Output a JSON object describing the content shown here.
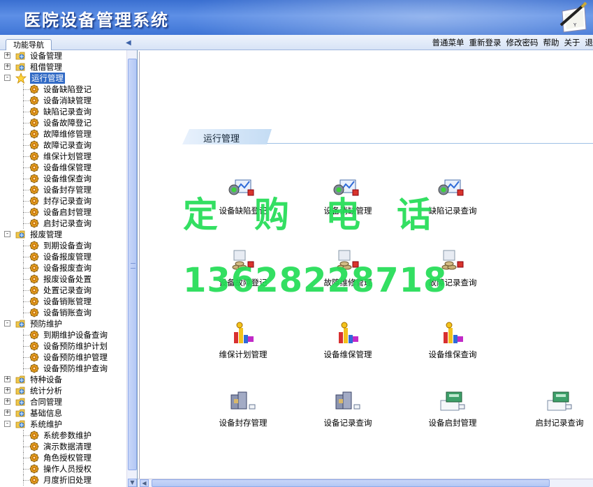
{
  "app": {
    "title": "医院设备管理系统"
  },
  "nav": {
    "tab_label": "功能导航"
  },
  "top_menu": [
    "普通菜单",
    "重新登录",
    "修改密码",
    "帮助",
    "关于",
    "退"
  ],
  "tree": [
    {
      "label": "设备管理",
      "level": 0,
      "expander": "+",
      "icon": "folder-icon"
    },
    {
      "label": "租借管理",
      "level": 0,
      "expander": "+",
      "icon": "folder-icon"
    },
    {
      "label": "运行管理",
      "level": 0,
      "expander": "-",
      "icon": "star-icon",
      "selected": true
    },
    {
      "label": "设备缺陷登记",
      "level": 1,
      "icon": "gear-icon"
    },
    {
      "label": "设备消缺管理",
      "level": 1,
      "icon": "gear-icon"
    },
    {
      "label": "缺陷记录查询",
      "level": 1,
      "icon": "gear-icon"
    },
    {
      "label": "设备故障登记",
      "level": 1,
      "icon": "gear-icon"
    },
    {
      "label": "故障维修管理",
      "level": 1,
      "icon": "gear-icon"
    },
    {
      "label": "故障记录查询",
      "level": 1,
      "icon": "gear-icon"
    },
    {
      "label": "维保计划管理",
      "level": 1,
      "icon": "gear-icon"
    },
    {
      "label": "设备维保管理",
      "level": 1,
      "icon": "gear-icon"
    },
    {
      "label": "设备维保查询",
      "level": 1,
      "icon": "gear-icon"
    },
    {
      "label": "设备封存管理",
      "level": 1,
      "icon": "gear-icon"
    },
    {
      "label": "封存记录查询",
      "level": 1,
      "icon": "gear-icon"
    },
    {
      "label": "设备启封管理",
      "level": 1,
      "icon": "gear-icon"
    },
    {
      "label": "启封记录查询",
      "level": 1,
      "icon": "gear-icon"
    },
    {
      "label": "报废管理",
      "level": 0,
      "expander": "-",
      "icon": "folder-icon"
    },
    {
      "label": "到期设备查询",
      "level": 1,
      "icon": "gear-icon"
    },
    {
      "label": "设备报废管理",
      "level": 1,
      "icon": "gear-icon"
    },
    {
      "label": "设备报废查询",
      "level": 1,
      "icon": "gear-icon"
    },
    {
      "label": "报废设备处置",
      "level": 1,
      "icon": "gear-icon"
    },
    {
      "label": "处置记录查询",
      "level": 1,
      "icon": "gear-icon"
    },
    {
      "label": "设备销账管理",
      "level": 1,
      "icon": "gear-icon"
    },
    {
      "label": "设备销账查询",
      "level": 1,
      "icon": "gear-icon"
    },
    {
      "label": "预防维护",
      "level": 0,
      "expander": "-",
      "icon": "folder-icon"
    },
    {
      "label": "到期维护设备查询",
      "level": 1,
      "icon": "gear-icon"
    },
    {
      "label": "设备预防维护计划",
      "level": 1,
      "icon": "gear-icon"
    },
    {
      "label": "设备预防维护管理",
      "level": 1,
      "icon": "gear-icon"
    },
    {
      "label": "设备预防维护查询",
      "level": 1,
      "icon": "gear-icon"
    },
    {
      "label": "特种设备",
      "level": 0,
      "expander": "+",
      "icon": "folder-icon"
    },
    {
      "label": "统计分析",
      "level": 0,
      "expander": "+",
      "icon": "folder-icon"
    },
    {
      "label": "合同管理",
      "level": 0,
      "expander": "+",
      "icon": "folder-icon"
    },
    {
      "label": "基础信息",
      "level": 0,
      "expander": "+",
      "icon": "folder-icon"
    },
    {
      "label": "系统维护",
      "level": 0,
      "expander": "-",
      "icon": "folder-icon"
    },
    {
      "label": "系统参数维护",
      "level": 1,
      "icon": "gear-icon"
    },
    {
      "label": "演示数据清理",
      "level": 1,
      "icon": "gear-icon"
    },
    {
      "label": "角色授权管理",
      "level": 1,
      "icon": "gear-icon"
    },
    {
      "label": "操作人员授权",
      "level": 1,
      "icon": "gear-icon"
    },
    {
      "label": "月度折旧处理",
      "level": 1,
      "icon": "gear-icon"
    }
  ],
  "main": {
    "section_title": "运行管理",
    "tiles": [
      {
        "label": "设备缺陷登记",
        "icon": "defect-register-icon"
      },
      {
        "label": "设备消缺管理",
        "icon": "defect-clear-icon"
      },
      {
        "label": "缺陷记录查询",
        "icon": "defect-query-icon"
      },
      {
        "label": "设备故障登记",
        "icon": "fault-register-icon"
      },
      {
        "label": "故障维修管理",
        "icon": "fault-repair-icon"
      },
      {
        "label": "故障记录查询",
        "icon": "fault-query-icon"
      },
      {
        "label": "维保计划管理",
        "icon": "maint-plan-icon"
      },
      {
        "label": "设备维保管理",
        "icon": "maint-manage-icon"
      },
      {
        "label": "设备维保查询",
        "icon": "maint-query-icon"
      },
      {
        "label": "设备封存管理",
        "icon": "seal-manage-icon"
      },
      {
        "label": "设备记录查询",
        "icon": "seal-query-icon"
      },
      {
        "label": "设备启封管理",
        "icon": "unseal-manage-icon"
      },
      {
        "label": "启封记录查询",
        "icon": "unseal-query-icon"
      }
    ]
  },
  "watermark": {
    "line1": "定购电话",
    "line2": "13628228718"
  },
  "colors": {
    "banner": "#3f75d6",
    "selected": "#316ac5",
    "watermark": "#22dd55"
  }
}
